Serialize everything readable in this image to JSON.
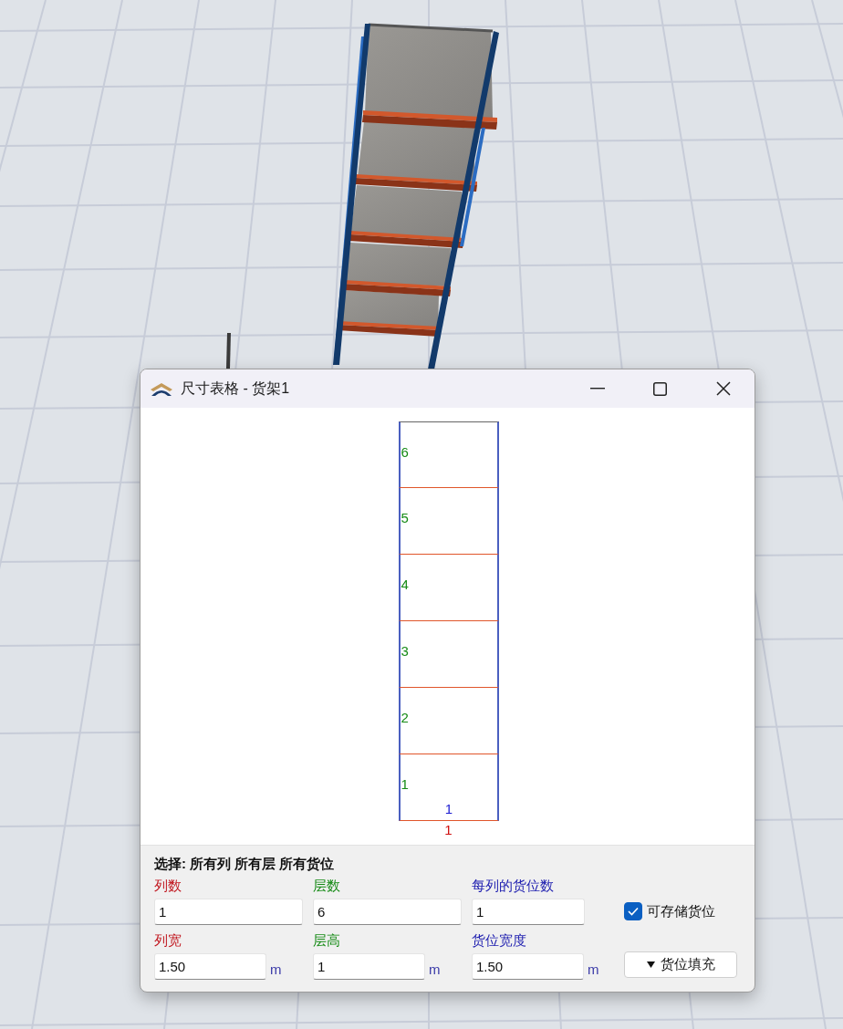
{
  "window": {
    "title": "尺寸表格 - 货架1"
  },
  "rack_grid": {
    "level_labels": [
      "6",
      "5",
      "4",
      "3",
      "2",
      "1"
    ],
    "slot_label": "1",
    "column_label": "1"
  },
  "selection": "选择: 所有列 所有层 所有货位",
  "fields": [
    {
      "label": "列数",
      "color": "#c0141c",
      "value": "1"
    },
    {
      "label": "层数",
      "color": "#158a15",
      "value": "6"
    },
    {
      "label": "每列的货位数",
      "color": "#2020b0",
      "value": "1"
    },
    {
      "label": "列宽",
      "color": "#c0141c",
      "value": "1.50",
      "unit": "m"
    },
    {
      "label": "层高",
      "color": "#158a15",
      "value": "1",
      "unit": "m"
    },
    {
      "label": "货位宽度",
      "color": "#2020b0",
      "value": "1.50",
      "unit": "m"
    }
  ],
  "storable": {
    "label": "可存储货位",
    "checked": true
  },
  "fill_button": {
    "label": "货位填充"
  }
}
